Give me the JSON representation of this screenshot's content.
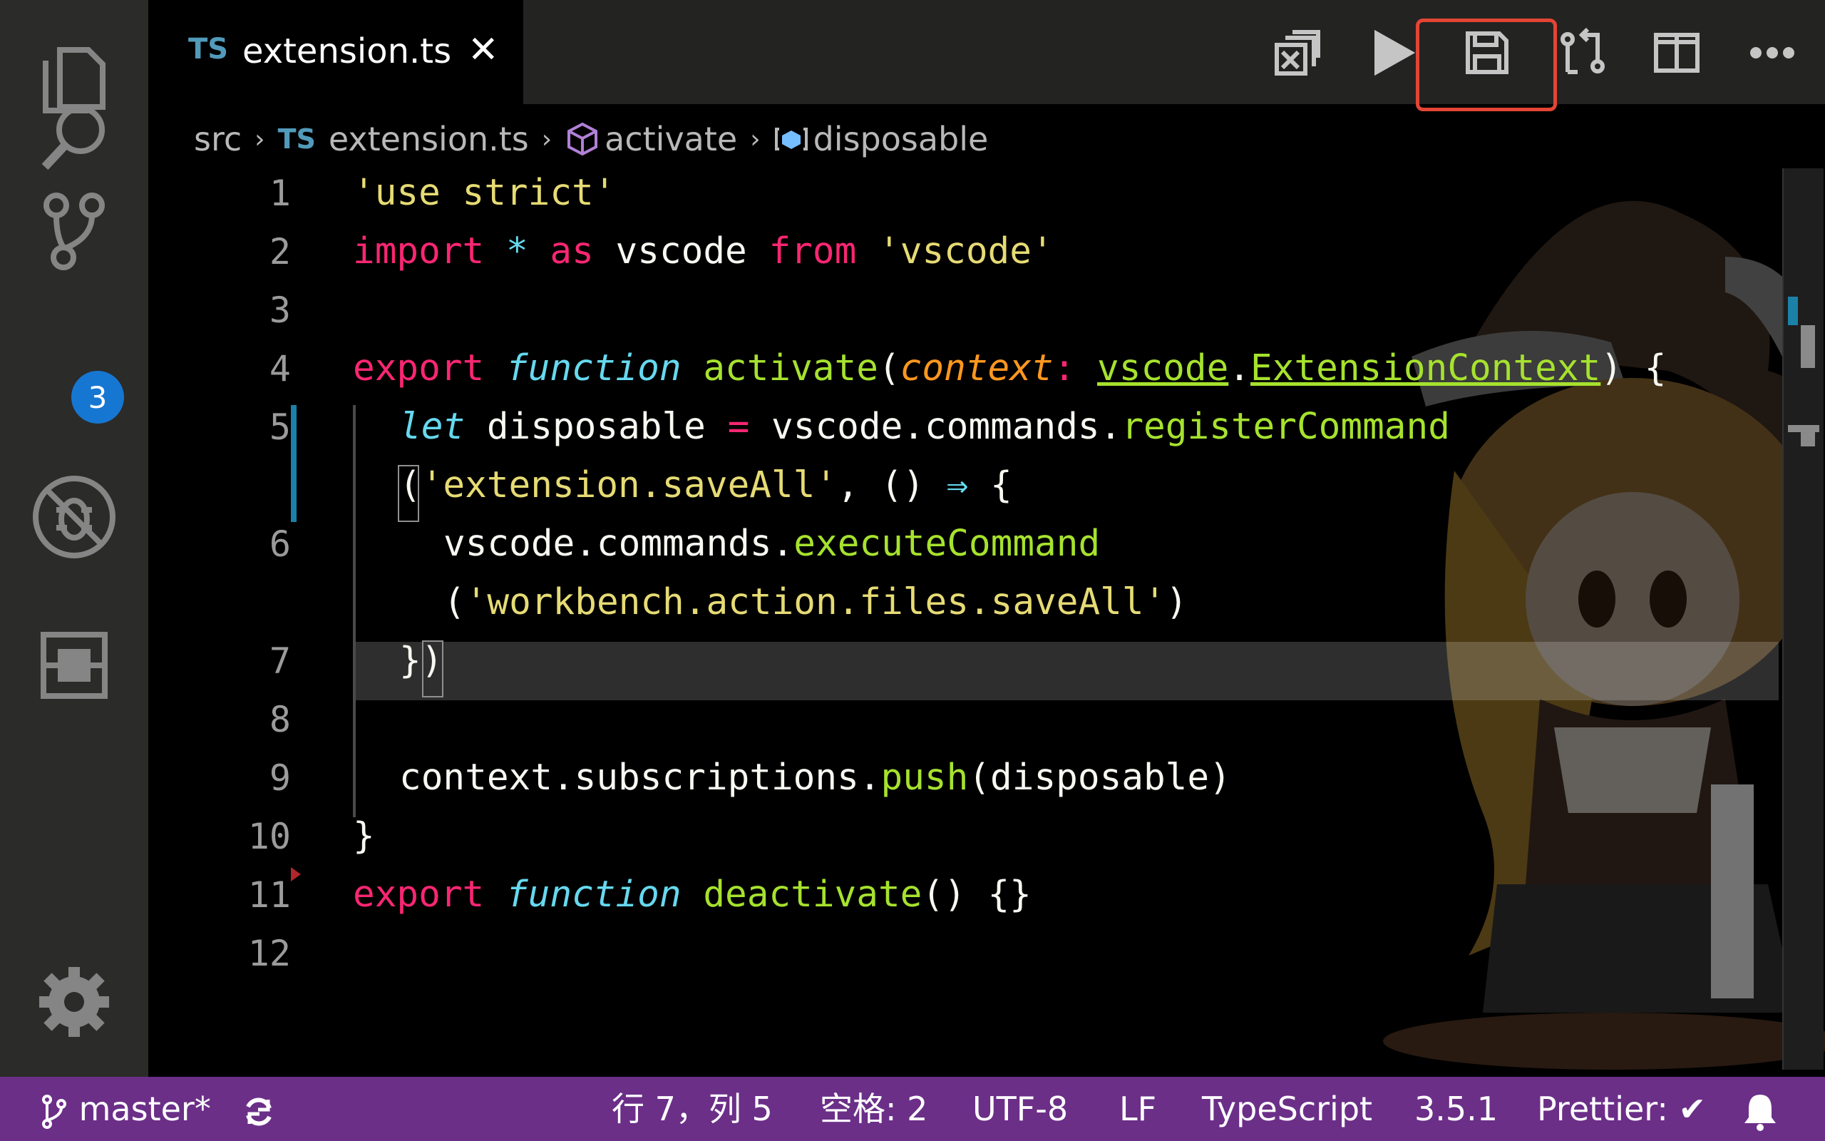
{
  "tab": {
    "lang": "TS",
    "filename": "extension.ts",
    "close": "✕"
  },
  "breadcrumb": {
    "folder": "src",
    "lang": "TS",
    "file": "extension.ts",
    "func": "activate",
    "var": "disposable"
  },
  "toolbar": [
    "copy-icon",
    "run-icon",
    "save-all-icon",
    "compare-icon",
    "split-icon",
    "more-icon"
  ],
  "activity": {
    "scm_badge": "3"
  },
  "line_numbers": [
    "1",
    "2",
    "3",
    "4",
    "5",
    "6",
    "7",
    "8",
    "9",
    "10",
    "11",
    "12"
  ],
  "code": {
    "l1": "'use strict'",
    "l2a": "import",
    "l2b": "*",
    "l2c": "as",
    "l2d": "vscode",
    "l2e": "from",
    "l2f": "'vscode'",
    "l4a": "export",
    "l4b": "function",
    "l4c": "activate",
    "l4d": "(",
    "l4e": "context",
    "l4f": ":",
    "l4g": "vscode",
    "l4h": ".",
    "l4i": "ExtensionContext",
    "l4j": ") {",
    "l5a": "let",
    "l5b": "disposable",
    "l5c": "=",
    "l5d": "vscode.commands.",
    "l5e": "registerCommand",
    "l5f": "(",
    "l5g": "'extension.saveAll'",
    "l5h": ", () ",
    "l5i": "⇒",
    "l5j": " {",
    "l6a": "vscode.commands.",
    "l6b": "executeCommand",
    "l6c": "(",
    "l6d": "'workbench.action.files.saveAll'",
    "l6e": ")",
    "l7": "})",
    "l9a": "context.subscriptions.",
    "l9b": "push",
    "l9c": "(disposable)",
    "l10": "}",
    "l11a": "export",
    "l11b": "function",
    "l11c": "deactivate",
    "l11d": "() {}"
  },
  "status": {
    "branch": "master*",
    "position": "行 7，列 5",
    "spaces": "空格: 2",
    "encoding": "UTF-8",
    "eol": "LF",
    "language": "TypeScript",
    "version": "3.5.1",
    "prettier": "Prettier: ✔"
  },
  "colors": {
    "statusbar": "#6b2f88",
    "accent_badge": "#1677d2",
    "highlight": "#e34534"
  }
}
